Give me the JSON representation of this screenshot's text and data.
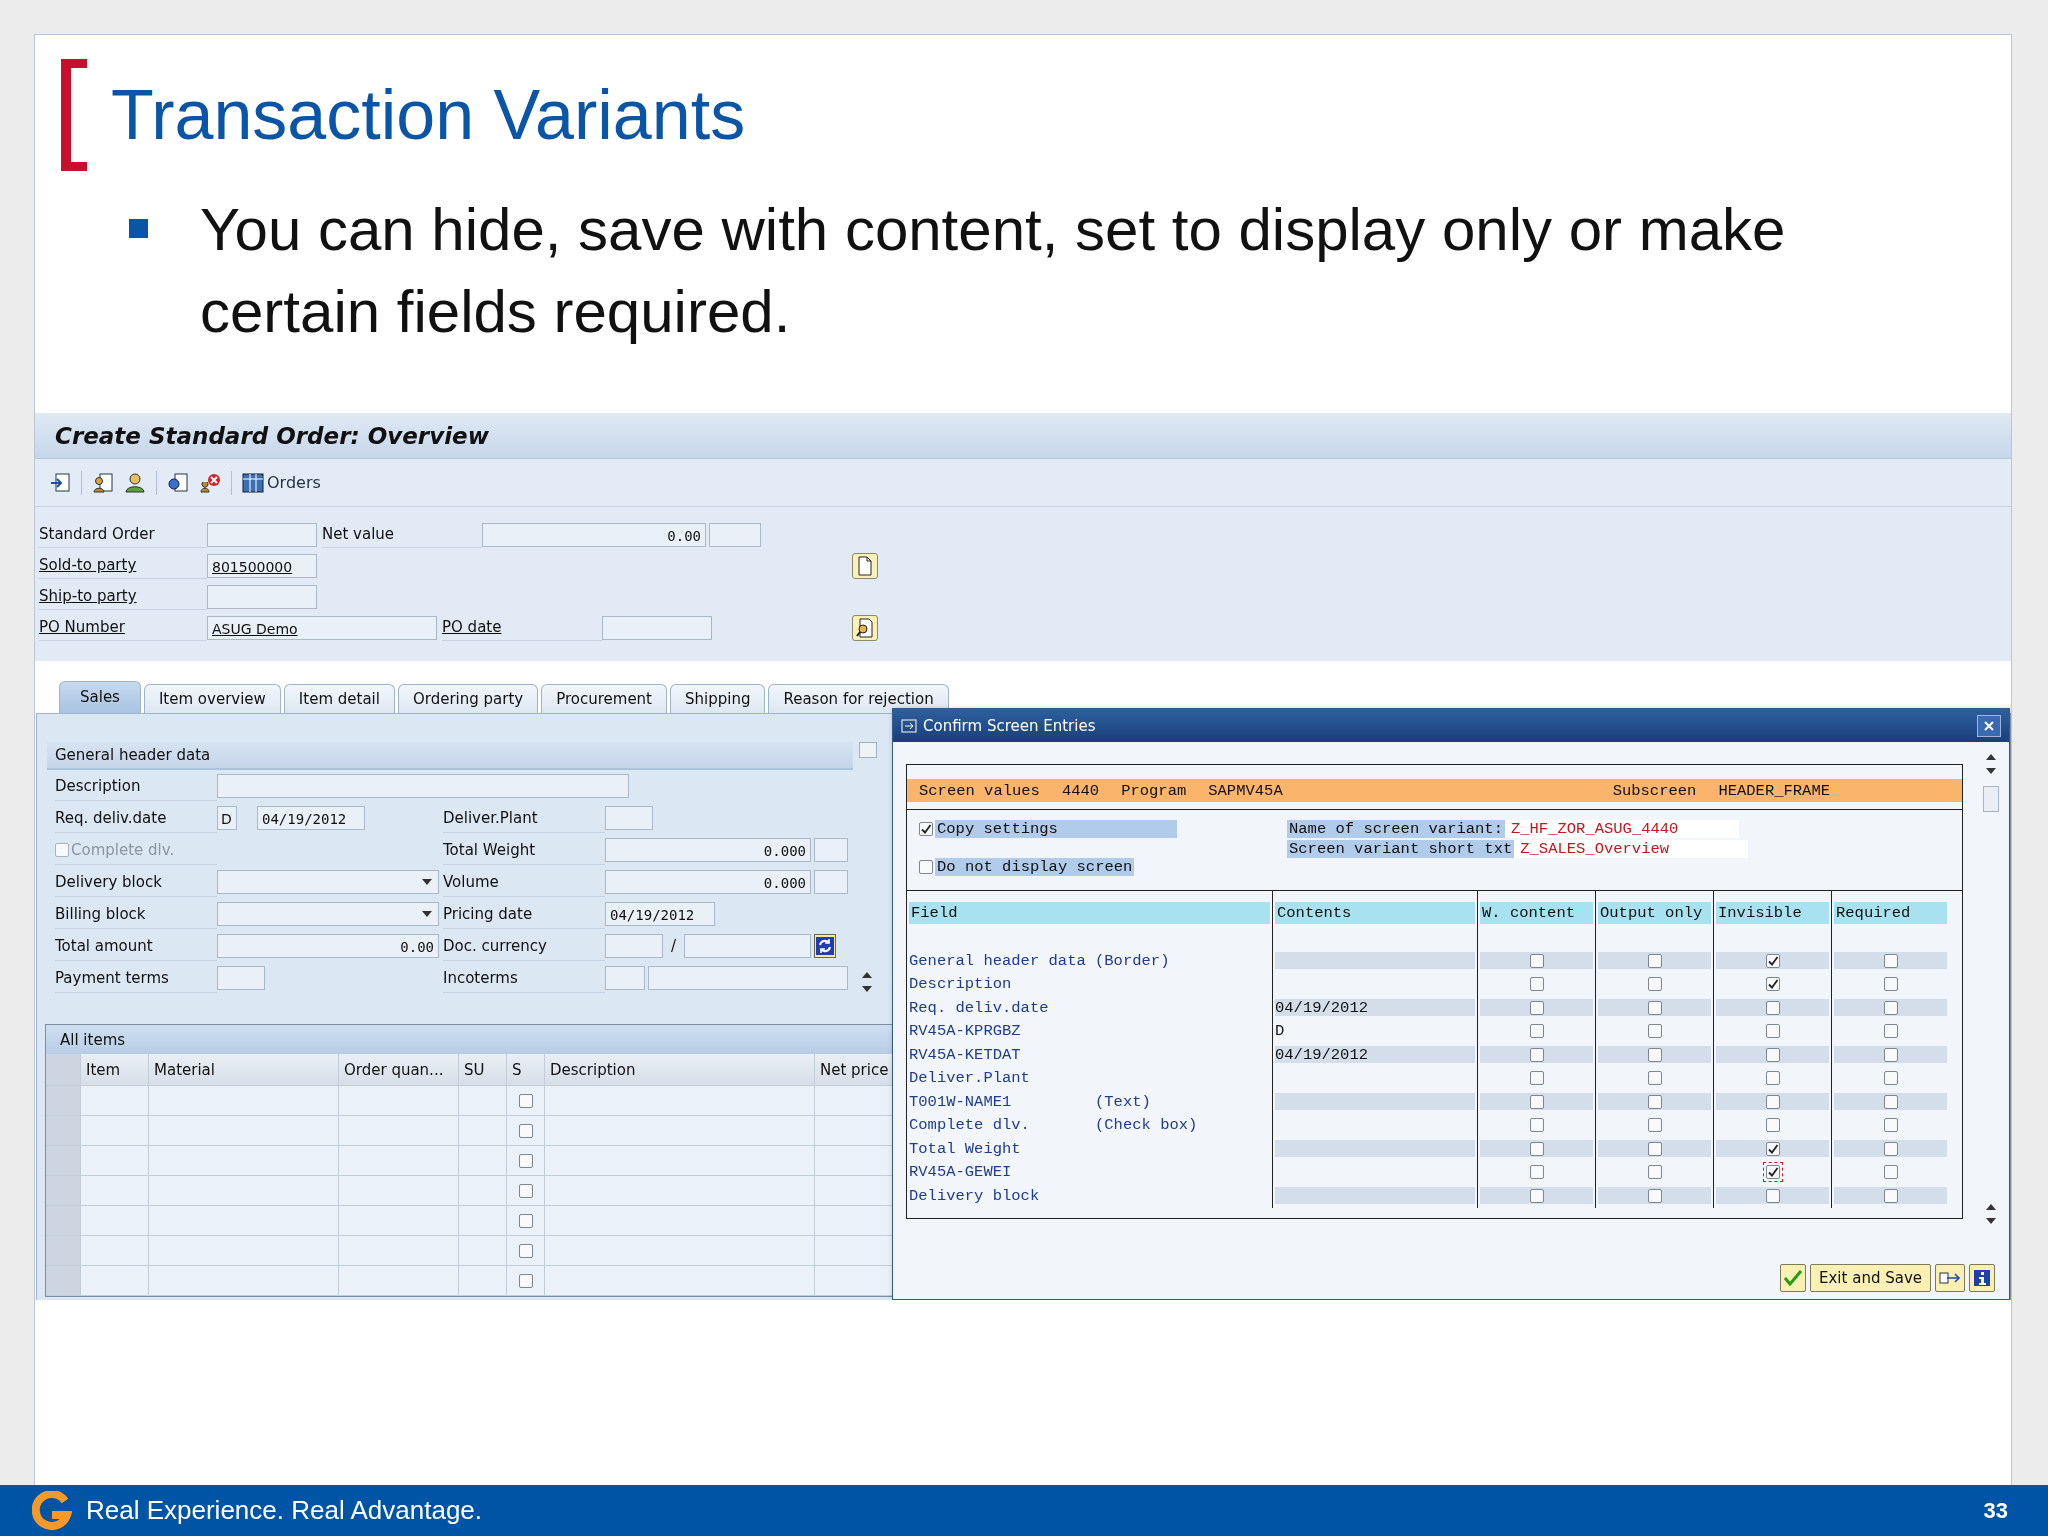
{
  "slide": {
    "title": "Transaction Variants",
    "bullets": [
      "You can hide, save with content, set to display only or make certain fields required."
    ]
  },
  "sap_window": {
    "title": "Create Standard Order: Overview",
    "toolbar": {
      "orders_button": "Orders"
    },
    "header_rows": [
      {
        "left": {
          "label": "Standard Order",
          "link": false
        },
        "right": {
          "label": "Net value",
          "link": false,
          "value": "0.00",
          "kind": "amount"
        }
      },
      {
        "left": {
          "label": "Sold-to party",
          "link": true,
          "value": "801500000"
        },
        "button": {
          "kind": "document"
        }
      },
      {
        "left": {
          "label": "Ship-to party",
          "link": true
        }
      },
      {
        "left": {
          "label": "PO Number",
          "link": true,
          "value": "ASUG Demo"
        },
        "right": {
          "label": "PO date",
          "link": true,
          "kind": "date"
        },
        "button": {
          "kind": "display"
        }
      }
    ],
    "tabs": [
      {
        "label": "Sales",
        "selected": true
      },
      {
        "label": "Item overview",
        "selected": false
      },
      {
        "label": "Item detail",
        "selected": false
      },
      {
        "label": "Ordering party",
        "selected": false
      },
      {
        "label": "Procurement",
        "selected": false
      },
      {
        "label": "Shipping",
        "selected": false
      },
      {
        "label": "Reason for rejection",
        "selected": false
      }
    ],
    "general_header": {
      "title": "General header data",
      "rows": [
        {
          "left": {
            "label": "Description",
            "kind": "wide"
          }
        },
        {
          "left": {
            "label": "Req. deliv.date",
            "kind": "date_pair",
            "values": [
              "D",
              "04/19/2012"
            ]
          },
          "right": {
            "label": "Deliver.Plant",
            "kind": "small"
          }
        },
        {
          "left": {
            "label": "Complete dlv.",
            "kind": "checkbox",
            "checked": false,
            "disabled": true
          },
          "right": {
            "label": "Total Weight",
            "kind": "quantity",
            "value": "0.000"
          }
        },
        {
          "left": {
            "label": "Delivery block",
            "kind": "dropdown"
          },
          "right": {
            "label": "Volume",
            "kind": "quantity",
            "value": "0.000"
          }
        },
        {
          "left": {
            "label": "Billing block",
            "kind": "dropdown"
          },
          "right": {
            "label": "Pricing date",
            "kind": "date",
            "value": "04/19/2012"
          }
        },
        {
          "left": {
            "label": "Total amount",
            "kind": "amount",
            "value": "0.00"
          },
          "right": {
            "label": "Doc. currency",
            "kind": "currency",
            "separator": "/"
          }
        },
        {
          "left": {
            "label": "Payment terms",
            "kind": "small"
          },
          "right": {
            "label": "Incoterms",
            "kind": "pair"
          }
        }
      ]
    },
    "all_items": {
      "title": "All items",
      "columns": [
        "Item",
        "Material",
        "Order quan...",
        "SU",
        "S",
        "Description",
        "Net price"
      ],
      "rows": [
        {
          "checked": false
        },
        {
          "checked": false
        },
        {
          "checked": false
        },
        {
          "checked": false
        },
        {
          "checked": false
        },
        {
          "checked": false
        },
        {
          "checked": false
        }
      ]
    }
  },
  "dialog": {
    "title": "Confirm Screen Entries",
    "screen_values": {
      "label": "Screen values",
      "number": "4440",
      "program_label": "Program",
      "program": "SAPMV45A",
      "subscreen_label": "Subscreen",
      "subscreen": "HEADER_FRAME"
    },
    "copy_settings": {
      "label": "Copy settings",
      "checked": true
    },
    "do_not_display": {
      "label": "Do not display screen",
      "checked": false
    },
    "variant_name": {
      "label": "Name of screen variant:",
      "value": "Z_HF_ZOR_ASUG_4440"
    },
    "variant_short_text": {
      "label": "Screen variant short txt",
      "value": "Z_SALES_Overview"
    },
    "table": {
      "columns": [
        "Field",
        "Contents",
        "W. content",
        "Output only",
        "Invisible",
        "Required"
      ],
      "rows": [
        {
          "field": "General header data",
          "note": "(Border)",
          "w_content": false,
          "output_only": false,
          "invisible": true,
          "required": false,
          "focused": false
        },
        {
          "field": "Description",
          "w_content": false,
          "output_only": false,
          "invisible": true,
          "required": false,
          "focused": false
        },
        {
          "field": "Req. deliv.date",
          "contents": "04/19/2012",
          "w_content": false,
          "output_only": false,
          "invisible": false,
          "required": false,
          "focused": false
        },
        {
          "field": "RV45A-KPRGBZ",
          "contents": "D",
          "w_content": false,
          "output_only": false,
          "invisible": false,
          "required": false,
          "focused": false
        },
        {
          "field": "RV45A-KETDAT",
          "contents": "04/19/2012",
          "w_content": false,
          "output_only": false,
          "invisible": false,
          "required": false,
          "focused": false
        },
        {
          "field": "Deliver.Plant",
          "w_content": false,
          "output_only": false,
          "invisible": false,
          "required": false,
          "focused": false
        },
        {
          "field": "T001W-NAME1",
          "note": "(Text)",
          "w_content": false,
          "output_only": false,
          "invisible": false,
          "required": false,
          "focused": false
        },
        {
          "field": "Complete dlv.",
          "note": "(Check box)",
          "w_content": false,
          "output_only": false,
          "invisible": false,
          "required": false,
          "focused": false
        },
        {
          "field": "Total Weight",
          "w_content": false,
          "output_only": false,
          "invisible": true,
          "required": false,
          "focused": false
        },
        {
          "field": "RV45A-GEWEI",
          "w_content": false,
          "output_only": false,
          "invisible": true,
          "required": false,
          "focused": true
        },
        {
          "field": "Delivery block",
          "w_content": false,
          "output_only": false,
          "invisible": false,
          "required": false,
          "focused": false
        }
      ]
    },
    "buttons": [
      {
        "label": "Exit and Save"
      }
    ]
  },
  "footer": {
    "tagline": "Real Experience. Real Advantage.",
    "page_number": "33"
  }
}
